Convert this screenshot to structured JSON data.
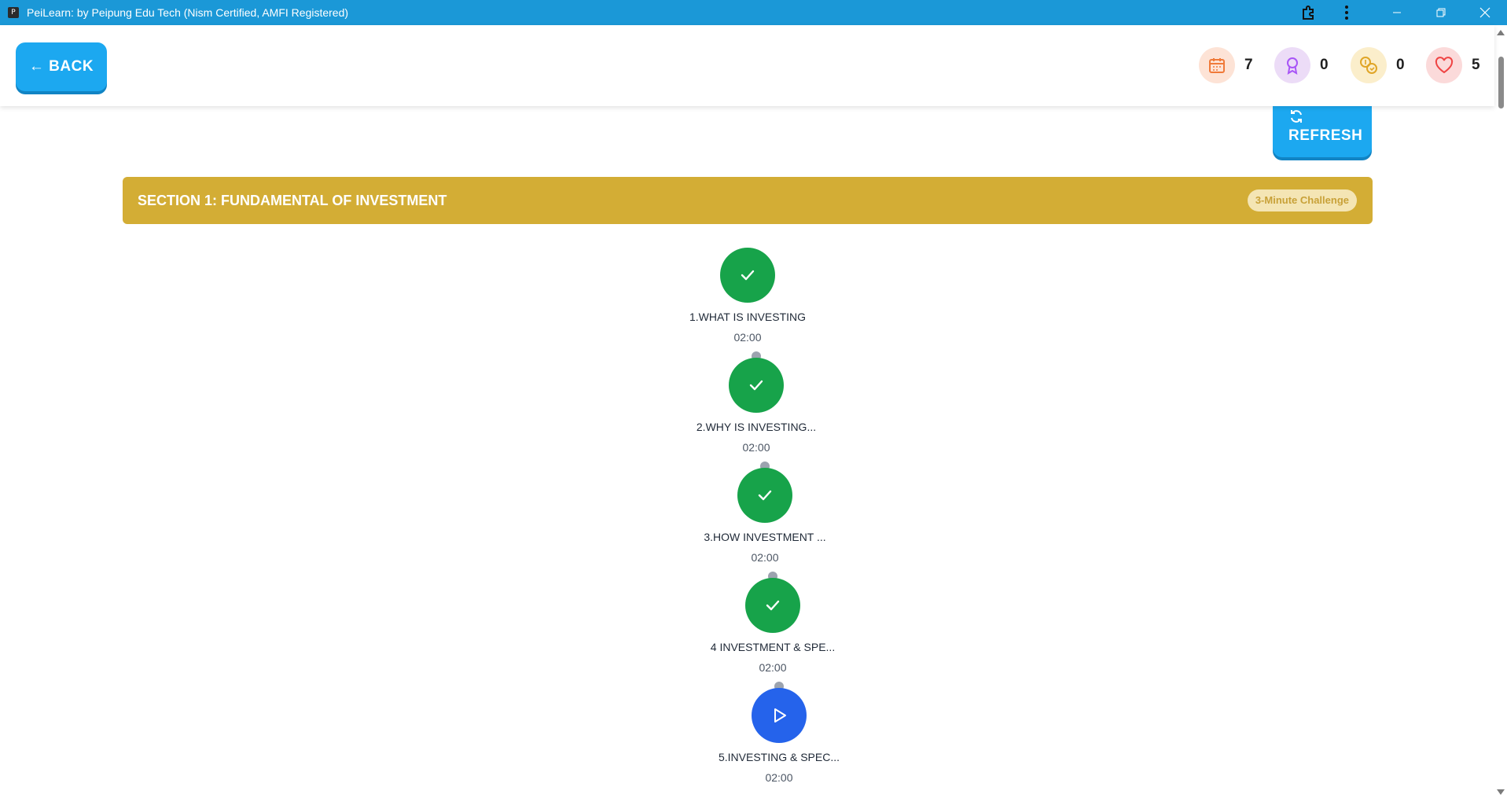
{
  "window": {
    "app_icon_letter": "P",
    "title": "PeiLearn: by Peipung Edu Tech (Nism Certified, AMFI Registered)"
  },
  "header": {
    "back_label": "← BACK",
    "stats": [
      {
        "name": "streak",
        "icon": "calendar-icon",
        "value": "7",
        "bg": "#fde3d6",
        "fg": "#f07a3a"
      },
      {
        "name": "badges",
        "icon": "award-icon",
        "value": "0",
        "bg": "#ecdcf7",
        "fg": "#a855f7"
      },
      {
        "name": "coins",
        "icon": "coins-icon",
        "value": "0",
        "bg": "#fbeecb",
        "fg": "#e0a526"
      },
      {
        "name": "lives",
        "icon": "heart-icon",
        "value": "5",
        "bg": "#fbdada",
        "fg": "#ef4444"
      }
    ]
  },
  "refresh_label": "REFRESH",
  "section": {
    "title": "SECTION 1: FUNDAMENTAL OF INVESTMENT",
    "badge": "3-Minute Challenge"
  },
  "lessons": [
    {
      "title": "1.WHAT IS INVESTING",
      "time": "02:00",
      "status": "completed"
    },
    {
      "title": "2.WHY IS INVESTING...",
      "time": "02:00",
      "status": "completed"
    },
    {
      "title": "3.HOW INVESTMENT ...",
      "time": "02:00",
      "status": "completed"
    },
    {
      "title": "4 INVESTMENT & SPE...",
      "time": "02:00",
      "status": "completed"
    },
    {
      "title": "5.INVESTING & SPEC...",
      "time": "02:00",
      "status": "current"
    }
  ],
  "colors": {
    "titlebar": "#1b98d7",
    "primary_button": "#1ca8f0",
    "section_bar": "#d3ad35",
    "completed": "#17a34a",
    "current": "#2563eb"
  }
}
